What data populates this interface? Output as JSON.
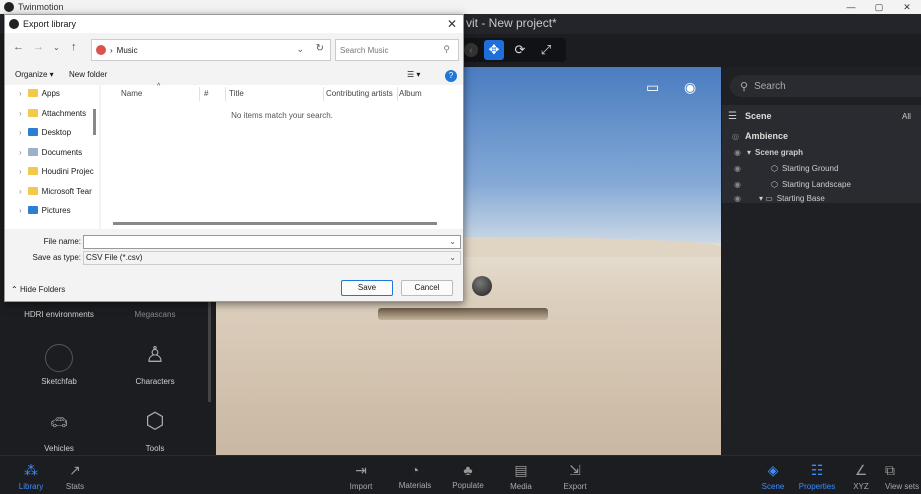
{
  "window": {
    "title": "Twinmotion",
    "min": "—",
    "max": "▢",
    "close": "✕"
  },
  "app": {
    "project_title": "vit - New project*"
  },
  "dialog": {
    "title": "Export library",
    "address_location": "Music",
    "search_placeholder": "Search Music",
    "organize_label": "Organize ▾",
    "new_folder_label": "New folder",
    "help_label": "?",
    "nav_items": [
      {
        "label": "Apps",
        "kind": "folder"
      },
      {
        "label": "Attachments",
        "kind": "folder"
      },
      {
        "label": "Desktop",
        "kind": "blue"
      },
      {
        "label": "Documents",
        "kind": "doc"
      },
      {
        "label": "Houdini Projec",
        "kind": "folder"
      },
      {
        "label": "Microsoft Tear",
        "kind": "folder"
      },
      {
        "label": "Pictures",
        "kind": "blue"
      }
    ],
    "columns": [
      "Name",
      "#",
      "Title",
      "Contributing artists",
      "Album"
    ],
    "empty_message": "No items match your search.",
    "file_name_label": "File name:",
    "file_name_value": "",
    "save_type_label": "Save as type:",
    "save_type_value": "CSV File (*.csv)",
    "hide_folders_label": "Hide Folders",
    "save_label": "Save",
    "cancel_label": "Cancel"
  },
  "library": {
    "items": [
      {
        "label": "HDRI environments"
      },
      {
        "label": "Megascans"
      },
      {
        "label": "Sketchfab"
      },
      {
        "label": "Characters"
      },
      {
        "label": "Vehicles"
      },
      {
        "label": "Tools"
      }
    ]
  },
  "right_panel": {
    "search_placeholder": "Search",
    "scene_label": "Scene",
    "filter_label": "All",
    "ambience_label": "Ambience",
    "tree": [
      {
        "label": "Scene graph"
      },
      {
        "label": "Starting Ground"
      },
      {
        "label": "Starting Landscape"
      },
      {
        "label": "Starting Base"
      }
    ]
  },
  "bottom_bar": {
    "left": [
      {
        "label": "Library",
        "active": true
      },
      {
        "label": "Stats",
        "active": false
      }
    ],
    "center": [
      {
        "label": "Import"
      },
      {
        "label": "Materials"
      },
      {
        "label": "Populate"
      },
      {
        "label": "Media"
      },
      {
        "label": "Export"
      }
    ],
    "right": [
      {
        "label": "Scene",
        "active": true
      },
      {
        "label": "Properties",
        "active": true
      },
      {
        "label": "XYZ",
        "active": false
      },
      {
        "label": "View sets",
        "active": false
      }
    ]
  },
  "colors": {
    "accent": "#3b8cff",
    "dialog_bg": "#f3f3f3"
  }
}
